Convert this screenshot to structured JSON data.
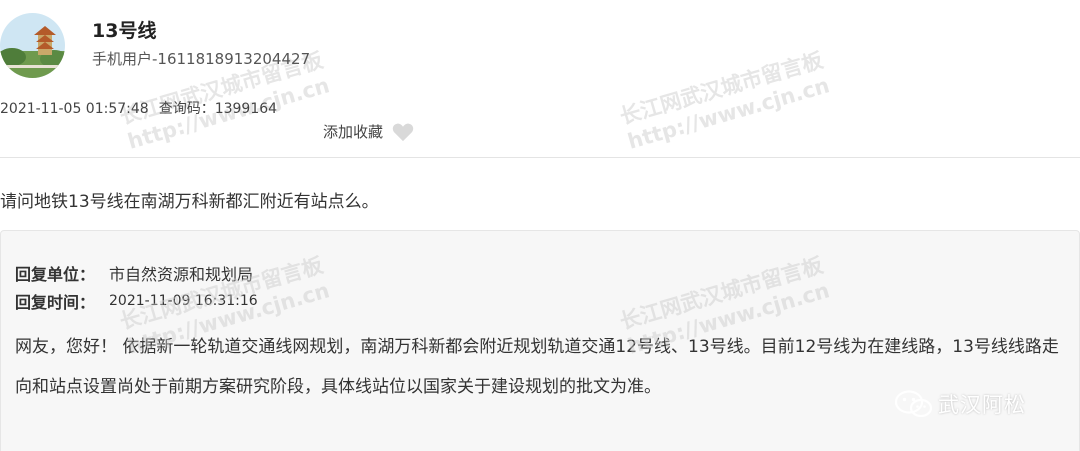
{
  "post": {
    "title": "13号线",
    "user": "手机用户-1611818913204427",
    "datetime": "2021-11-05 01:57:48",
    "query_label": "查询码：",
    "query_code": "1399164",
    "favorite_label": "添加收藏"
  },
  "question": "请问地铁13号线在南湖万科新都汇附近有站点么。",
  "reply": {
    "dept_label": "回复单位：",
    "dept_value": "市自然资源和规划局",
    "time_label": "回复时间：",
    "time_value": "2021-11-09 16:31:16",
    "body": "网友，您好！ 依据新一轮轨道交通线网规划，南湖万科新都会附近规划轨道交通12号线、13号线。目前12号线为在建线路，13号线线路走向和站点设置尚处于前期方案研究阶段，具体线站位以国家关于建设规划的批文为准。"
  },
  "watermark": {
    "line1": "长江网武汉城市留言板",
    "line2": "http://www.cjn.cn"
  },
  "brand": {
    "name": "武汉阿松",
    "icon": "wechat-icon"
  },
  "colors": {
    "reply_bg": "#f7f7f7",
    "heart": "#d9d9d9"
  }
}
